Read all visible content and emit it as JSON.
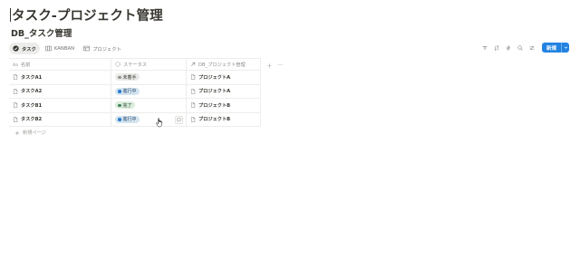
{
  "page": {
    "title": "タスク-プロジェクト管理",
    "database_title": "DB_タスク管理"
  },
  "views": [
    {
      "label": "タスク",
      "icon": "check-circle-icon",
      "active": true
    },
    {
      "label": "KANBAN",
      "icon": "board-icon",
      "active": false
    },
    {
      "label": "プロジェクト",
      "icon": "table-icon",
      "active": false
    }
  ],
  "toolbar": {
    "icons": [
      "filter-icon",
      "sort-icon",
      "lightning-icon",
      "search-icon",
      "settings-icon"
    ],
    "new_label": "新規"
  },
  "table": {
    "columns": [
      {
        "label": "名前",
        "icon": "text-aa-icon"
      },
      {
        "label": "ステータス",
        "icon": "status-icon"
      },
      {
        "label": "DB_プロジェクト管理",
        "icon": "relation-arrow-icon"
      }
    ],
    "rows": [
      {
        "name": "タスクA1",
        "status": "未着手",
        "project": "プロジェクトA"
      },
      {
        "name": "タスクA2",
        "status": "進行中",
        "project": "プロジェクトA"
      },
      {
        "name": "タスクB1",
        "status": "完了",
        "project": "プロジェクトB"
      },
      {
        "name": "タスクB2",
        "status": "進行中",
        "project": "プロジェクトB"
      }
    ],
    "new_page_label": "新規ページ"
  },
  "status_colors": {
    "未着手": {
      "bg": "#e9e9e7",
      "dot": "#91918e",
      "text": "#37352f"
    },
    "進行中": {
      "bg": "#d3e5ef",
      "dot": "#2e7cd1",
      "text": "#28456c"
    },
    "完了": {
      "bg": "#dbeddb",
      "dot": "#448361",
      "text": "#1c3829"
    }
  },
  "colors": {
    "accent": "#2383e2",
    "text": "#37352f",
    "muted": "#8d8b86",
    "border": "#ededec"
  }
}
